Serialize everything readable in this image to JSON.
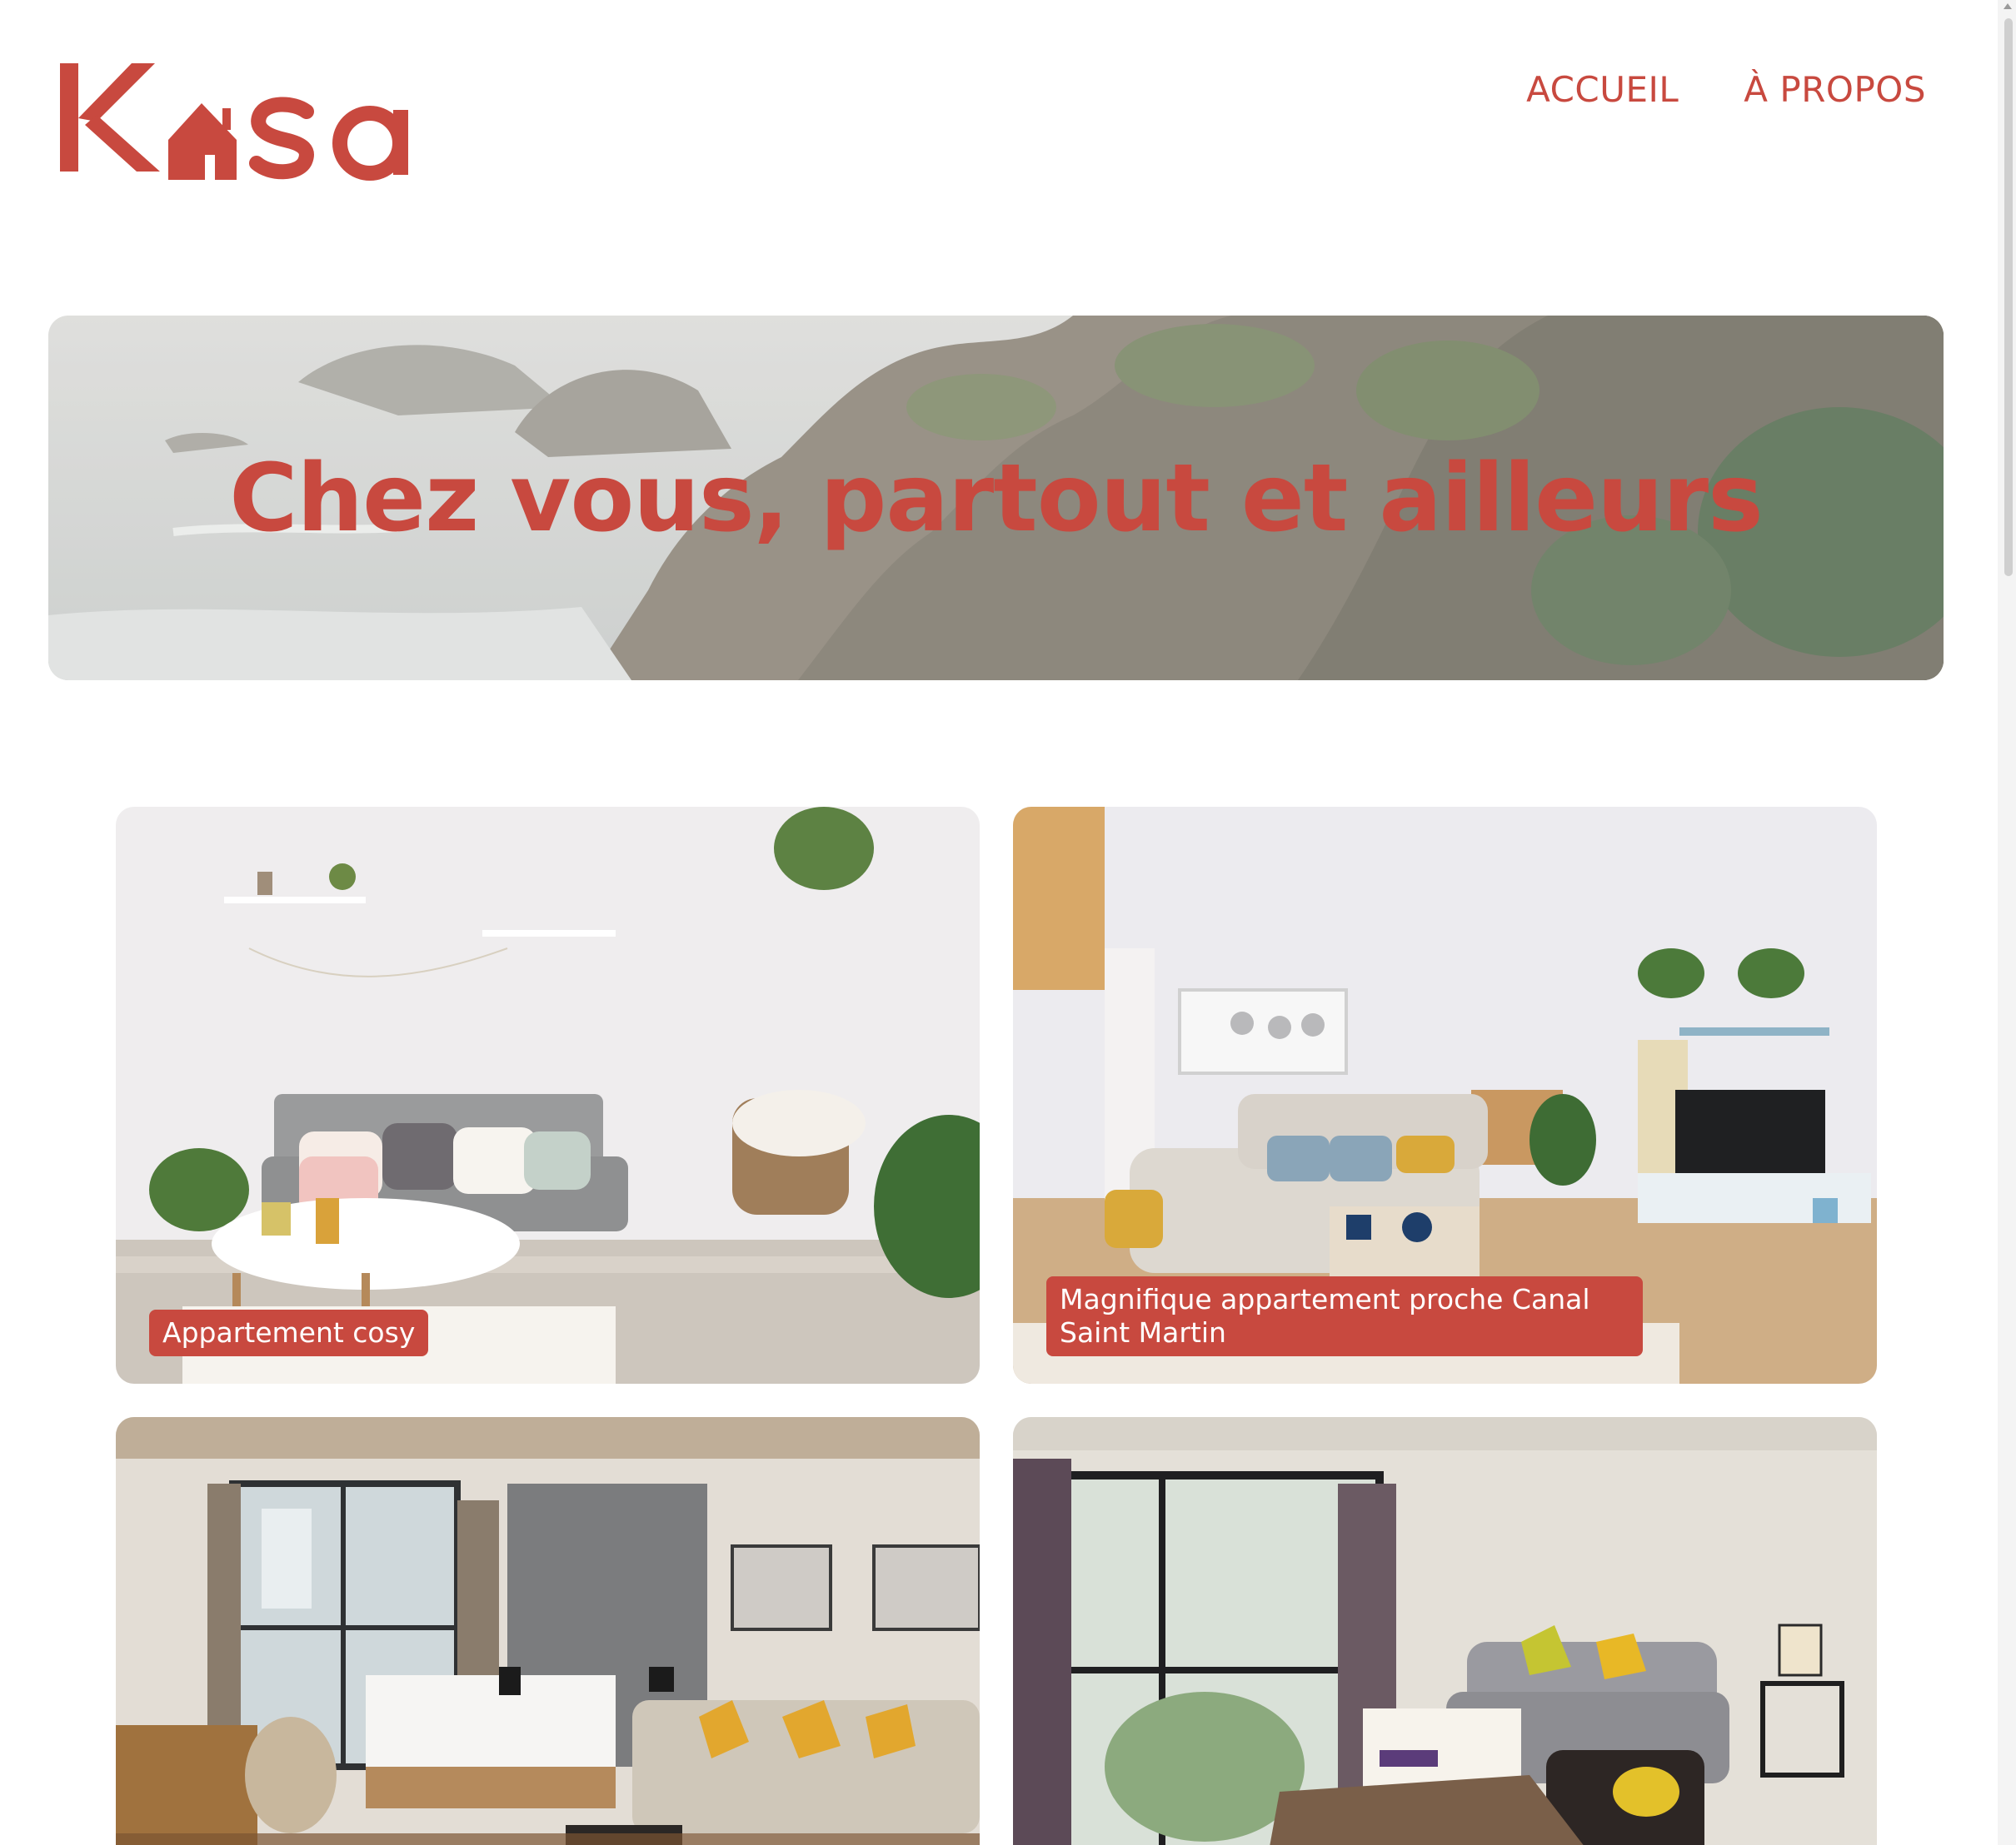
{
  "brand": {
    "logo_text": "Kasa",
    "accent_color": "#c8493f"
  },
  "nav": {
    "items": [
      {
        "label": "ACCUEIL"
      },
      {
        "label": "À PROPOS"
      }
    ]
  },
  "banner": {
    "title": "Chez vous, partout et ailleurs"
  },
  "listings": [
    {
      "title": "Appartement cosy"
    },
    {
      "title": "Magnifique appartement proche Canal Saint Martin"
    },
    {
      "title": ""
    },
    {
      "title": ""
    }
  ]
}
